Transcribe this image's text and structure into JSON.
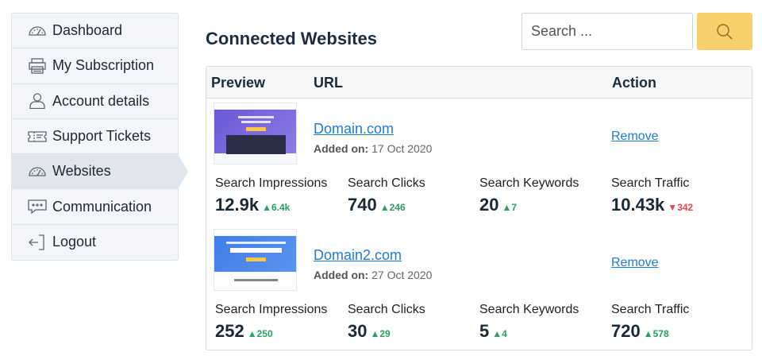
{
  "sidebar": {
    "items": [
      {
        "label": "Dashboard",
        "icon": "gauge-icon"
      },
      {
        "label": "My Subscription",
        "icon": "printer-icon"
      },
      {
        "label": "Account details",
        "icon": "user-icon"
      },
      {
        "label": "Support Tickets",
        "icon": "ticket-icon"
      },
      {
        "label": "Websites",
        "icon": "gauge-icon",
        "active": true
      },
      {
        "label": "Communication",
        "icon": "chat-icon"
      },
      {
        "label": "Logout",
        "icon": "logout-icon"
      }
    ]
  },
  "header": {
    "title": "Connected Websites",
    "search_placeholder": "Search ...",
    "search_icon": "search-icon",
    "accent": "#f7d06b"
  },
  "table": {
    "columns": {
      "preview": "Preview",
      "url": "URL",
      "action": "Action"
    },
    "added_prefix": "Added on:",
    "sites": [
      {
        "domain": "Domain.com",
        "added_on": "17 Oct 2020",
        "action": "Remove",
        "metrics": [
          {
            "label": "Search Impressions",
            "value": "12.9k",
            "delta": "6.4k",
            "direction": "up"
          },
          {
            "label": "Search Clicks",
            "value": "740",
            "delta": "246",
            "direction": "up"
          },
          {
            "label": "Search Keywords",
            "value": "20",
            "delta": "7",
            "direction": "up"
          },
          {
            "label": "Search Traffic",
            "value": "10.43k",
            "delta": "342",
            "direction": "down"
          }
        ]
      },
      {
        "domain": "Domain2.com",
        "added_on": "27 Oct 2020",
        "action": "Remove",
        "metrics": [
          {
            "label": "Search Impressions",
            "value": "252",
            "delta": "250",
            "direction": "up"
          },
          {
            "label": "Search Clicks",
            "value": "30",
            "delta": "29",
            "direction": "up"
          },
          {
            "label": "Search Keywords",
            "value": "5",
            "delta": "4",
            "direction": "up"
          },
          {
            "label": "Search Traffic",
            "value": "720",
            "delta": "578",
            "direction": "up"
          }
        ]
      }
    ]
  },
  "colors": {
    "up": "#2aa063",
    "down": "#e5484d",
    "link": "#1f7bd8"
  }
}
